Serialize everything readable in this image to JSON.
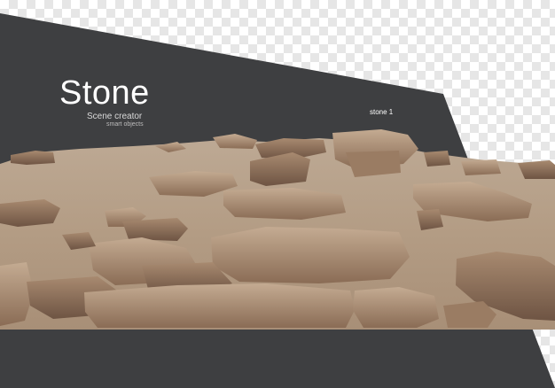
{
  "header": {
    "title": "Stone",
    "subtitle": "Scene creator",
    "caption": "smart objects",
    "label": "stone 1"
  },
  "colors": {
    "panel": "#3e3f41",
    "checker_light": "#ffffff",
    "checker_dark": "#e6e6e6",
    "ground": "#b8a48f",
    "rock": "#a0826a"
  }
}
